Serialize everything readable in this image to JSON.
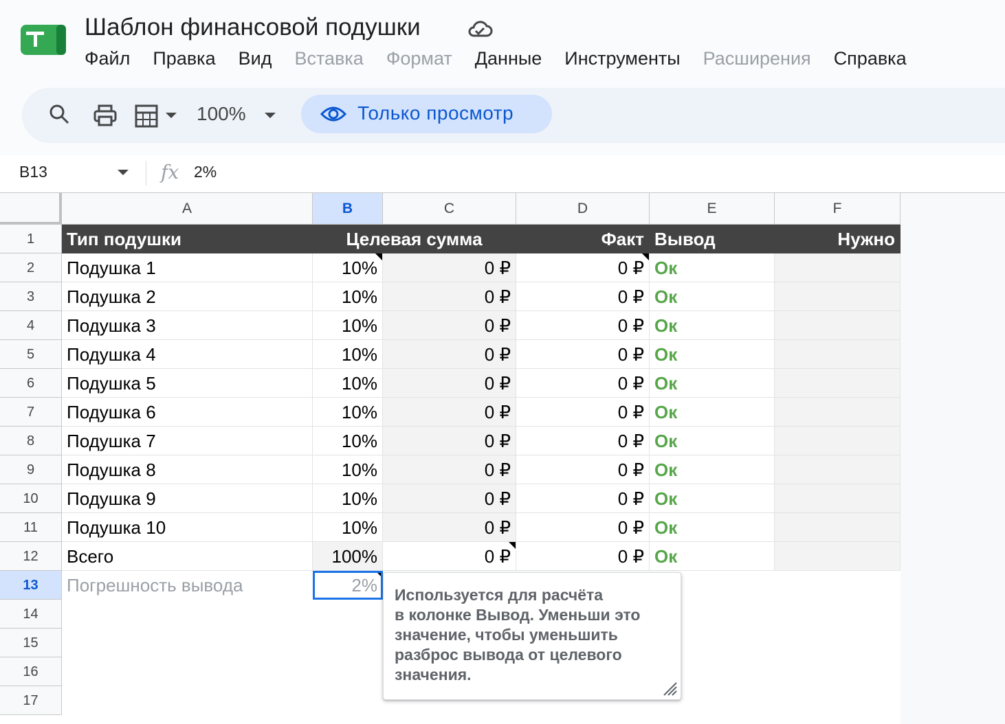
{
  "app": {
    "logo_icon": "google-sheets-logo",
    "cloud_icon": "cloud-saved-icon"
  },
  "document": {
    "title": "Шаблон финансовой подушки"
  },
  "menu": [
    {
      "label": "Файл",
      "enabled": true
    },
    {
      "label": "Правка",
      "enabled": true
    },
    {
      "label": "Вид",
      "enabled": true
    },
    {
      "label": "Вставка",
      "enabled": false
    },
    {
      "label": "Формат",
      "enabled": false
    },
    {
      "label": "Данные",
      "enabled": true
    },
    {
      "label": "Инструменты",
      "enabled": true
    },
    {
      "label": "Расширения",
      "enabled": false
    },
    {
      "label": "Справка",
      "enabled": true
    }
  ],
  "toolbar": {
    "search_icon": "search-icon",
    "print_icon": "print-icon",
    "view_icon": "grid-view-icon",
    "zoom": "100%",
    "view_only_label": "Только просмотр",
    "view_only_icon": "eye-icon"
  },
  "formula_bar": {
    "name_box": "B13",
    "fx_label": "fx",
    "value": "2%"
  },
  "sheet": {
    "columns": [
      "A",
      "B",
      "C",
      "D",
      "E",
      "F"
    ],
    "selected_column": "B",
    "selected_row": "13",
    "row_numbers": [
      "1",
      "2",
      "3",
      "4",
      "5",
      "6",
      "7",
      "8",
      "9",
      "10",
      "11",
      "12",
      "13",
      "14",
      "15",
      "16",
      "17"
    ],
    "header_row": [
      "Тип подушки",
      "Целевая сумма",
      "",
      "Факт",
      "Вывод",
      "Нужно"
    ],
    "rows": [
      [
        "Подушка 1",
        "10%",
        "0 ₽",
        "0 ₽",
        "Ок",
        ""
      ],
      [
        "Подушка 2",
        "10%",
        "0 ₽",
        "0 ₽",
        "Ок",
        ""
      ],
      [
        "Подушка 3",
        "10%",
        "0 ₽",
        "0 ₽",
        "Ок",
        ""
      ],
      [
        "Подушка 4",
        "10%",
        "0 ₽",
        "0 ₽",
        "Ок",
        ""
      ],
      [
        "Подушка 5",
        "10%",
        "0 ₽",
        "0 ₽",
        "Ок",
        ""
      ],
      [
        "Подушка 6",
        "10%",
        "0 ₽",
        "0 ₽",
        "Ок",
        ""
      ],
      [
        "Подушка 7",
        "10%",
        "0 ₽",
        "0 ₽",
        "Ок",
        ""
      ],
      [
        "Подушка 8",
        "10%",
        "0 ₽",
        "0 ₽",
        "Ок",
        ""
      ],
      [
        "Подушка 9",
        "10%",
        "0 ₽",
        "0 ₽",
        "Ок",
        ""
      ],
      [
        "Подушка 10",
        "10%",
        "0 ₽",
        "0 ₽",
        "Ок",
        ""
      ],
      [
        "Всего",
        "100%",
        "0 ₽",
        "0 ₽",
        "Ок",
        ""
      ],
      [
        "Погрешность вывода",
        "2%",
        "",
        "",
        "",
        ""
      ]
    ]
  },
  "note": {
    "text": "Используется для расчёта\nв колонке Вывод. Уменьши это\nзначение, чтобы уменьшить\nразброс вывода от целевого\nзначения."
  },
  "colors": {
    "accent": "#0b57d0",
    "header_bg": "#434343",
    "ok_green": "#57a64a",
    "selection": "#1a73e8"
  }
}
